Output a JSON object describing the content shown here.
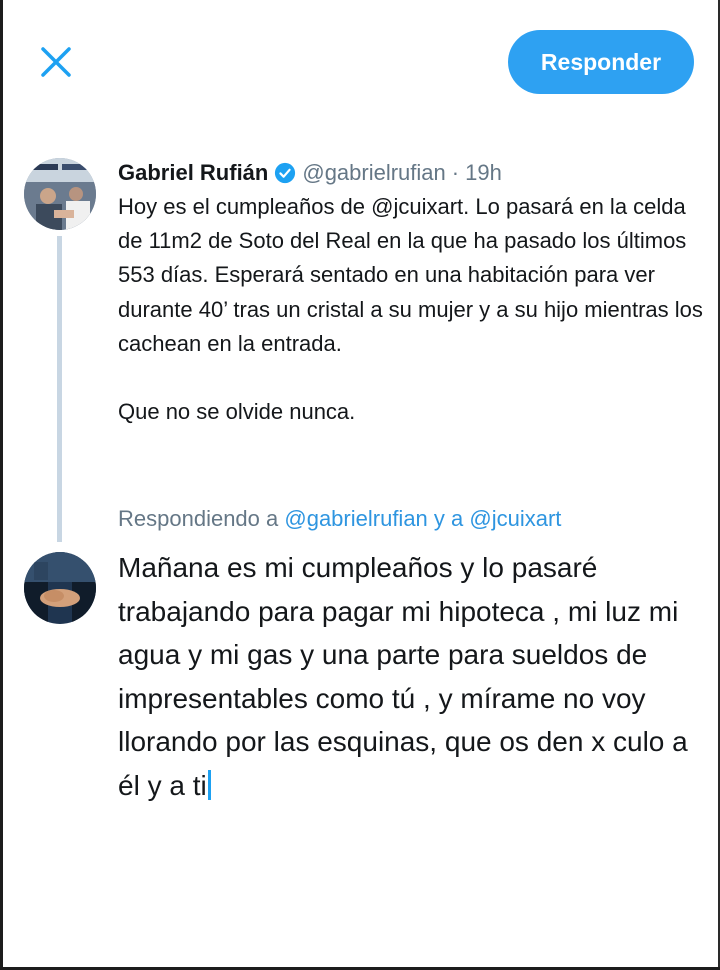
{
  "toolbar": {
    "close_icon": "close-icon",
    "reply_label": "Responder",
    "accent_color": "#2ea1f2"
  },
  "original_tweet": {
    "author_name": "Gabriel Rufián",
    "verified_icon": "verified-badge-icon",
    "handle": "@gabrielrufian",
    "separator": "·",
    "time": "19h",
    "paragraph_1": "Hoy es el cumpleaños de @jcuixart. Lo pasará en la celda de 11m2 de Soto del Real en la que ha pasado los últimos 553 días. Esperará sentado en una habitación para ver durante 40’ tras un cristal a su mujer y a su hijo mientras los cachean en la entrada.",
    "paragraph_2": "Que no se olvide nunca."
  },
  "reply_compose": {
    "replying_prefix": "Respondiendo a",
    "replying_user_1": "@gabrielrufian",
    "replying_and": "y a",
    "replying_user_2": "@jcuixart",
    "text": "Mañana es mi cumpleaños y lo pasaré trabajando para pagar mi hipoteca , mi luz mi agua y mi gas y una parte para sueldos de impresentables como tú , y mírame no voy llorando por las esquinas, que os den x culo a él y a ti"
  }
}
